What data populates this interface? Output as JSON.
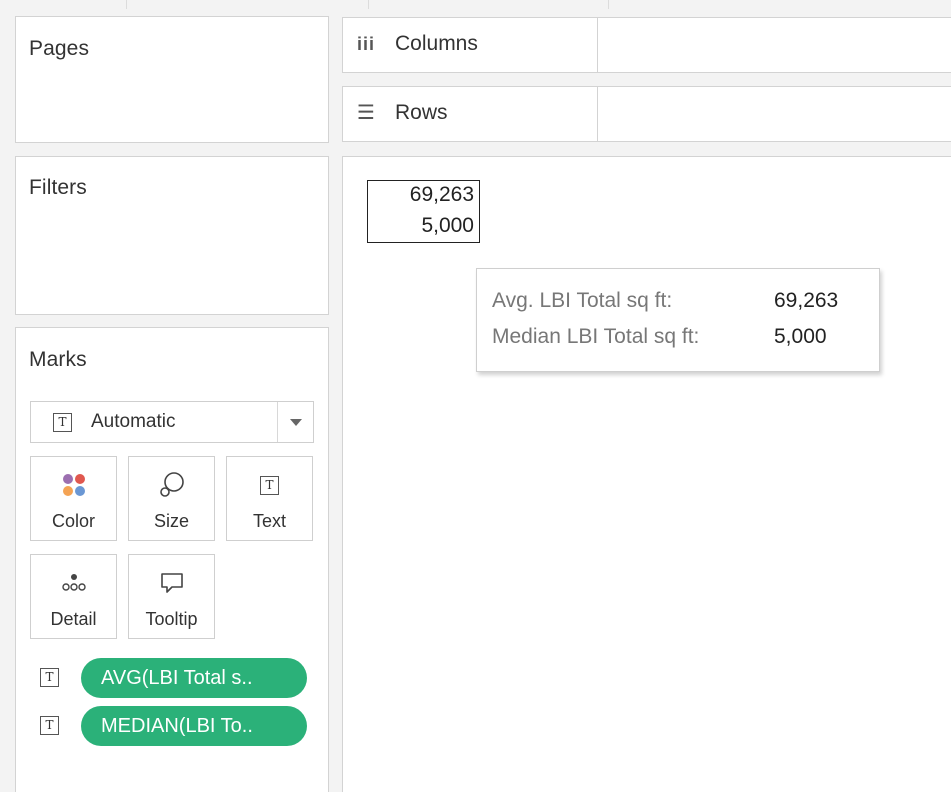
{
  "left_panel": {
    "pages_title": "Pages",
    "filters_title": "Filters",
    "marks_title": "Marks",
    "mark_type": "Automatic",
    "mark_buttons": {
      "color": "Color",
      "size": "Size",
      "text": "Text",
      "detail": "Detail",
      "tooltip": "Tooltip"
    },
    "pills": [
      {
        "label": "AVG(LBI Total s..",
        "type_icon": "T"
      },
      {
        "label": "MEDIAN(LBI To..",
        "type_icon": "T"
      }
    ]
  },
  "shelves": {
    "columns_label": "Columns",
    "rows_label": "Rows",
    "columns_icon": "iii",
    "rows_icon": "☰"
  },
  "view": {
    "mark_values": [
      "69,263",
      "5,000"
    ],
    "tooltip": {
      "rows": [
        {
          "label": "Avg. LBI Total sq ft:",
          "value": "69,263"
        },
        {
          "label": "Median LBI Total sq ft:",
          "value": "5,000"
        }
      ]
    }
  },
  "colors": {
    "pill_green": "#2bb179",
    "color_dots": [
      "#9c6fb0",
      "#e0584f",
      "#f4a354",
      "#6a97d4"
    ]
  }
}
